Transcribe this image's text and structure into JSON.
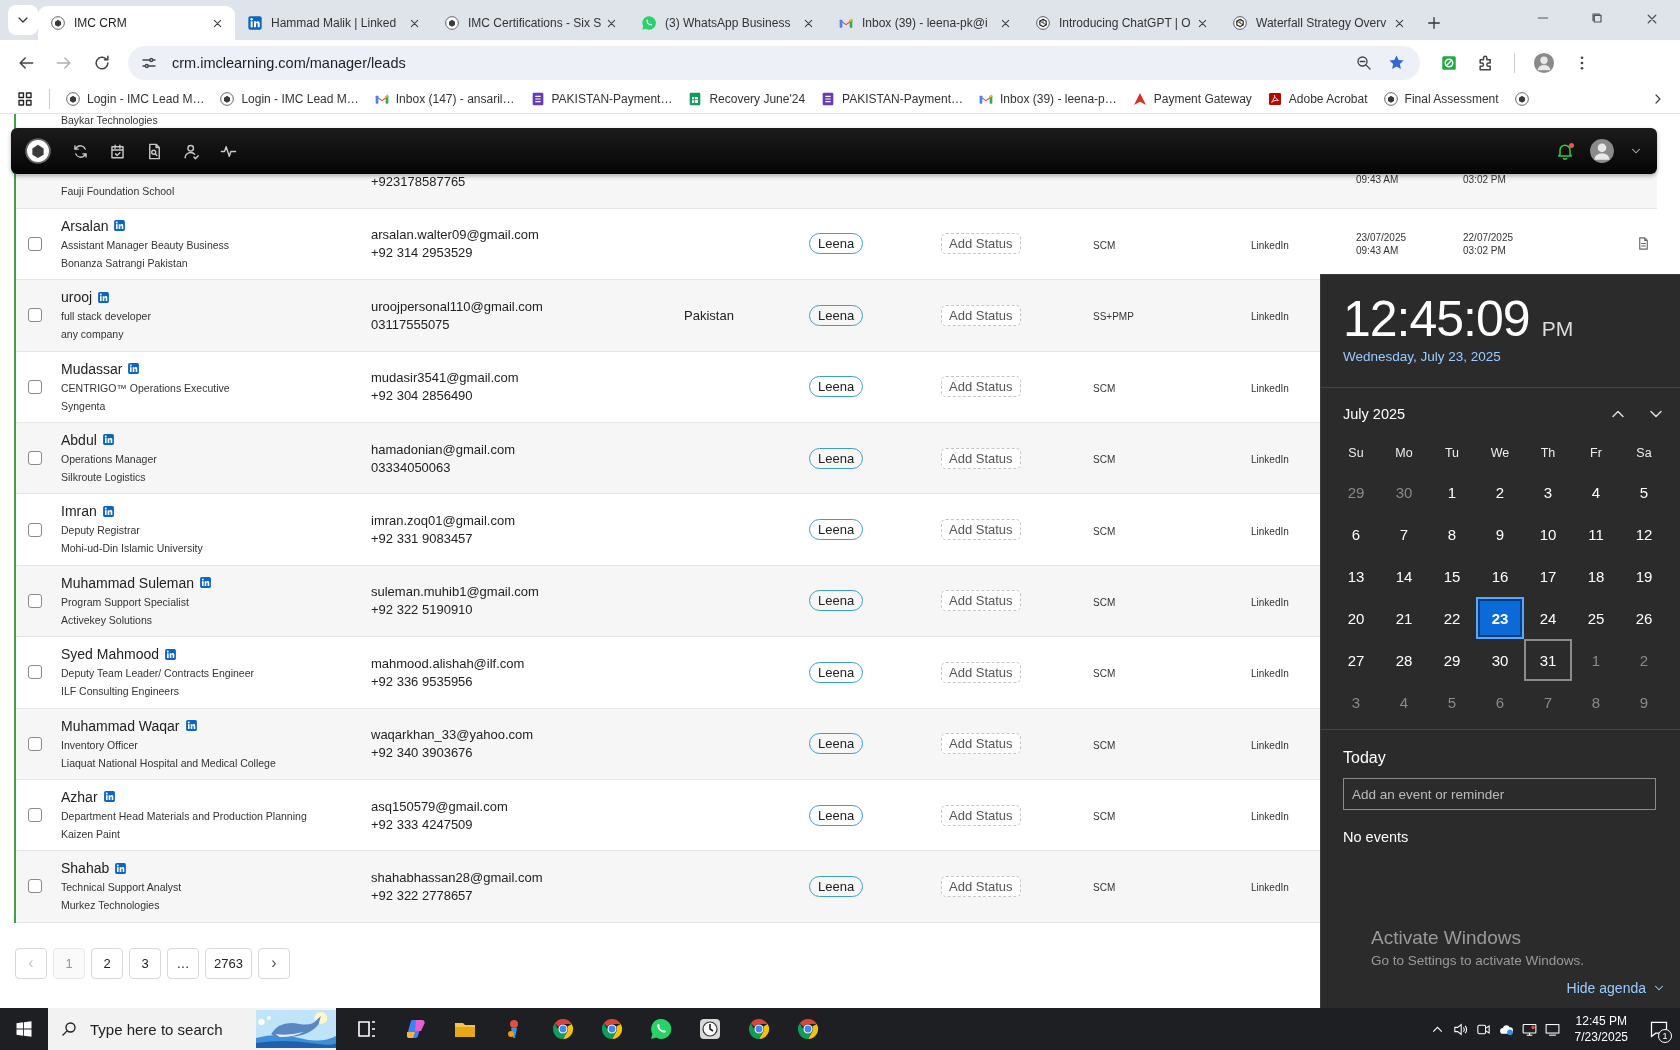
{
  "browser": {
    "tabs": [
      {
        "title": "IMC CRM",
        "kind": "emblem",
        "selected": true
      },
      {
        "title": "Hammad Malik | Linked",
        "kind": "in-square",
        "selected": false
      },
      {
        "title": "IMC Certifications - Six S",
        "kind": "emblem",
        "selected": false
      },
      {
        "title": "(3) WhatsApp Business",
        "kind": "chat",
        "selected": false
      },
      {
        "title": "Inbox (39) - leena-pk@i",
        "kind": "mail",
        "selected": false
      },
      {
        "title": "Introducing ChatGPT | O",
        "kind": "knot",
        "selected": false
      },
      {
        "title": "Waterfall Strategy Overv",
        "kind": "knot",
        "selected": false
      }
    ],
    "address": "crm.imclearning.com/manager/leads",
    "bookmarks": [
      {
        "label": "Login - IMC Lead M…",
        "kind": "emblem"
      },
      {
        "label": "Login - IMC Lead M…",
        "kind": "emblem"
      },
      {
        "label": "Inbox (147) - ansaril…",
        "kind": "mail"
      },
      {
        "label": "PAKISTAN-Payment…",
        "kind": "form"
      },
      {
        "label": "Recovery June'24",
        "kind": "sheet"
      },
      {
        "label": "PAKISTAN-Payment…",
        "kind": "form"
      },
      {
        "label": "Inbox (39) - leena-p…",
        "kind": "mail"
      },
      {
        "label": "Payment Gateway",
        "kind": "triangle"
      },
      {
        "label": "Adobe Acrobat",
        "kind": "pdf"
      },
      {
        "label": "Final Assessment",
        "kind": "emblem"
      },
      {
        "kind": "emblem"
      }
    ]
  },
  "leads": {
    "rows": [
      {
        "company": "Baykar Technologies"
      },
      {
        "company": "Fauji Foundation School",
        "phone": "+923178587765",
        "created_time": "09:43 AM",
        "updated_time": "03:02 PM"
      },
      {
        "name": "Arsalan",
        "linkedin": true,
        "title": "Assistant Manager Beauty Business",
        "company": "Bonanza Satrangi Pakistan",
        "email": "arsalan.walter09@gmail.com",
        "phone": "+92 314 2953529",
        "owner": "Leena",
        "status": "Add Status",
        "program": "SCM",
        "source": "LinkedIn",
        "created_date": "23/07/2025",
        "created_time": "09:43 AM",
        "updated_date": "22/07/2025",
        "updated_time": "03:02 PM",
        "document": true,
        "checked": false
      },
      {
        "name": "urooj",
        "linkedin": true,
        "title": "full stack developer",
        "company": "any company",
        "email": "uroojpersonal110@gmail.com",
        "phone": "03117555075",
        "country": "Pakistan",
        "owner": "Leena",
        "status": "Add Status",
        "program": "SS+PMP",
        "source": "LinkedIn",
        "checked": false
      },
      {
        "name": "Mudassar",
        "linkedin": true,
        "title": "CENTRIGO™ Operations Executive",
        "company": "Syngenta",
        "email": "mudasir3541@gmail.com",
        "phone": "+92 304 2856490",
        "owner": "Leena",
        "status": "Add Status",
        "program": "SCM",
        "source": "LinkedIn",
        "checked": false
      },
      {
        "name": "Abdul",
        "linkedin": true,
        "title": "Operations Manager",
        "company": "Silkroute Logistics",
        "email": "hamadonian@gmail.com",
        "phone": "03334050063",
        "owner": "Leena",
        "status": "Add Status",
        "program": "SCM",
        "source": "LinkedIn",
        "checked": false
      },
      {
        "name": "Imran",
        "linkedin": true,
        "title": "Deputy Registrar",
        "company": "Mohi-ud-Din Islamic University",
        "email": "imran.zoq01@gmail.com",
        "phone": "+92 331 9083457",
        "owner": "Leena",
        "status": "Add Status",
        "program": "SCM",
        "source": "LinkedIn",
        "checked": false
      },
      {
        "name": "Muhammad Suleman",
        "linkedin": true,
        "title": "Program Support Specialist",
        "company": "Activekey Solutions",
        "email": "suleman.muhib1@gmail.com",
        "phone": "+92 322 5190910",
        "owner": "Leena",
        "status": "Add Status",
        "program": "SCM",
        "source": "LinkedIn",
        "checked": false
      },
      {
        "name": "Syed Mahmood",
        "linkedin": true,
        "title": "Deputy Team Leader/ Contracts Engineer",
        "company": "ILF Consulting Engineers",
        "email": "mahmood.alishah@ilf.com",
        "phone": "+92 336 9535956",
        "owner": "Leena",
        "status": "Add Status",
        "program": "SCM",
        "source": "LinkedIn",
        "checked": false
      },
      {
        "name": "Muhammad Waqar",
        "linkedin": true,
        "title": "Inventory Officer",
        "company": "Liaquat National Hospital and Medical College",
        "email": "waqarkhan_33@yahoo.com",
        "phone": "+92 340 3903676",
        "owner": "Leena",
        "status": "Add Status",
        "program": "SCM",
        "source": "LinkedIn",
        "checked": false
      },
      {
        "name": "Azhar",
        "linkedin": true,
        "title": "Department Head Materials and Production Planning",
        "company": "Kaizen Paint",
        "email": "asq150579@gmail.com",
        "phone": "+92 333 4247509",
        "owner": "Leena",
        "status": "Add Status",
        "program": "SCM",
        "source": "LinkedIn",
        "checked": false
      },
      {
        "name": "Shahab",
        "linkedin": true,
        "title": "Technical Support Analyst",
        "company": "Murkez Technologies",
        "email": "shahabhassan28@gmail.com",
        "phone": "+92 322 2778657",
        "owner": "Leena",
        "status": "Add Status",
        "program": "SCM",
        "source": "LinkedIn",
        "checked": false
      }
    ],
    "pagination": [
      {
        "label": "‹",
        "kind": "prev",
        "selected": false,
        "disabled": true
      },
      {
        "label": "1",
        "kind": "page",
        "selected": true,
        "disabled": false
      },
      {
        "label": "2",
        "kind": "page",
        "selected": false,
        "disabled": false
      },
      {
        "label": "3",
        "kind": "page",
        "selected": false,
        "disabled": false
      },
      {
        "label": "…",
        "kind": "page",
        "selected": false,
        "disabled": false
      },
      {
        "label": "2763",
        "kind": "page",
        "selected": false,
        "disabled": false
      },
      {
        "label": "›",
        "kind": "next",
        "selected": false,
        "disabled": false
      }
    ]
  },
  "app_bar": {
    "icons": [
      {
        "kind": "sync"
      },
      {
        "kind": "calendar"
      },
      {
        "kind": "doc-search"
      },
      {
        "kind": "person"
      },
      {
        "kind": "pulse"
      }
    ],
    "notification_unread": true
  },
  "calendar": {
    "time": "12:45:09",
    "meridiem": "PM",
    "date": "Wednesday, July 23, 2025",
    "month": "July 2025",
    "weekdays": [
      "Su",
      "Mo",
      "Tu",
      "We",
      "Th",
      "Fr",
      "Sa"
    ],
    "days": [
      {
        "day": "29",
        "in_month": false,
        "selected": false,
        "focused": false
      },
      {
        "day": "30",
        "in_month": false,
        "selected": false,
        "focused": false
      },
      {
        "day": "1",
        "in_month": true,
        "selected": false,
        "focused": false
      },
      {
        "day": "2",
        "in_month": true,
        "selected": false,
        "focused": false
      },
      {
        "day": "3",
        "in_month": true,
        "selected": false,
        "focused": false
      },
      {
        "day": "4",
        "in_month": true,
        "selected": false,
        "focused": false
      },
      {
        "day": "5",
        "in_month": true,
        "selected": false,
        "focused": false
      },
      {
        "day": "6",
        "in_month": true,
        "selected": false,
        "focused": false
      },
      {
        "day": "7",
        "in_month": true,
        "selected": false,
        "focused": false
      },
      {
        "day": "8",
        "in_month": true,
        "selected": false,
        "focused": false
      },
      {
        "day": "9",
        "in_month": true,
        "selected": false,
        "focused": false
      },
      {
        "day": "10",
        "in_month": true,
        "selected": false,
        "focused": false
      },
      {
        "day": "11",
        "in_month": true,
        "selected": false,
        "focused": false
      },
      {
        "day": "12",
        "in_month": true,
        "selected": false,
        "focused": false
      },
      {
        "day": "13",
        "in_month": true,
        "selected": false,
        "focused": false
      },
      {
        "day": "14",
        "in_month": true,
        "selected": false,
        "focused": false
      },
      {
        "day": "15",
        "in_month": true,
        "selected": false,
        "focused": false
      },
      {
        "day": "16",
        "in_month": true,
        "selected": false,
        "focused": false
      },
      {
        "day": "17",
        "in_month": true,
        "selected": false,
        "focused": false
      },
      {
        "day": "18",
        "in_month": true,
        "selected": false,
        "focused": false
      },
      {
        "day": "19",
        "in_month": true,
        "selected": false,
        "focused": false
      },
      {
        "day": "20",
        "in_month": true,
        "selected": false,
        "focused": false
      },
      {
        "day": "21",
        "in_month": true,
        "selected": false,
        "focused": false
      },
      {
        "day": "22",
        "in_month": true,
        "selected": false,
        "focused": false
      },
      {
        "day": "23",
        "in_month": true,
        "selected": true,
        "focused": false
      },
      {
        "day": "24",
        "in_month": true,
        "selected": false,
        "focused": false
      },
      {
        "day": "25",
        "in_month": true,
        "selected": false,
        "focused": false
      },
      {
        "day": "26",
        "in_month": true,
        "selected": false,
        "focused": false
      },
      {
        "day": "27",
        "in_month": true,
        "selected": false,
        "focused": false
      },
      {
        "day": "28",
        "in_month": true,
        "selected": false,
        "focused": false
      },
      {
        "day": "29",
        "in_month": true,
        "selected": false,
        "focused": false
      },
      {
        "day": "30",
        "in_month": true,
        "selected": false,
        "focused": false
      },
      {
        "day": "31",
        "in_month": true,
        "selected": false,
        "focused": true
      },
      {
        "day": "1",
        "in_month": false,
        "selected": false,
        "focused": false
      },
      {
        "day": "2",
        "in_month": false,
        "selected": false,
        "focused": false
      },
      {
        "day": "3",
        "in_month": false,
        "selected": false,
        "focused": false
      },
      {
        "day": "4",
        "in_month": false,
        "selected": false,
        "focused": false
      },
      {
        "day": "5",
        "in_month": false,
        "selected": false,
        "focused": false
      },
      {
        "day": "6",
        "in_month": false,
        "selected": false,
        "focused": false
      },
      {
        "day": "7",
        "in_month": false,
        "selected": false,
        "focused": false
      },
      {
        "day": "8",
        "in_month": false,
        "selected": false,
        "focused": false
      },
      {
        "day": "9",
        "in_month": false,
        "selected": false,
        "focused": false
      }
    ],
    "agenda_title": "Today",
    "event_placeholder": "Add an event or reminder",
    "agenda_empty": "No events",
    "activation_title": "Activate Windows",
    "activation_hint": "Go to Settings to activate Windows.",
    "hide_agenda": "Hide agenda"
  },
  "taskbar": {
    "search_placeholder": "Type here to search",
    "apps": [
      {
        "kind": "task-view"
      },
      {
        "kind": "assistant"
      },
      {
        "kind": "folder"
      },
      {
        "kind": "app"
      },
      {
        "kind": "browser"
      },
      {
        "kind": "browser"
      },
      {
        "kind": "chat"
      },
      {
        "kind": "clock"
      },
      {
        "kind": "browser"
      },
      {
        "kind": "browser"
      }
    ],
    "tray": [
      {
        "kind": "chevron-up"
      },
      {
        "kind": "speaker"
      },
      {
        "kind": "camera"
      },
      {
        "kind": "cloud"
      },
      {
        "kind": "network"
      },
      {
        "kind": "display"
      }
    ],
    "time": "12:45 PM",
    "date": "7/23/2025",
    "notification_count": "1"
  }
}
